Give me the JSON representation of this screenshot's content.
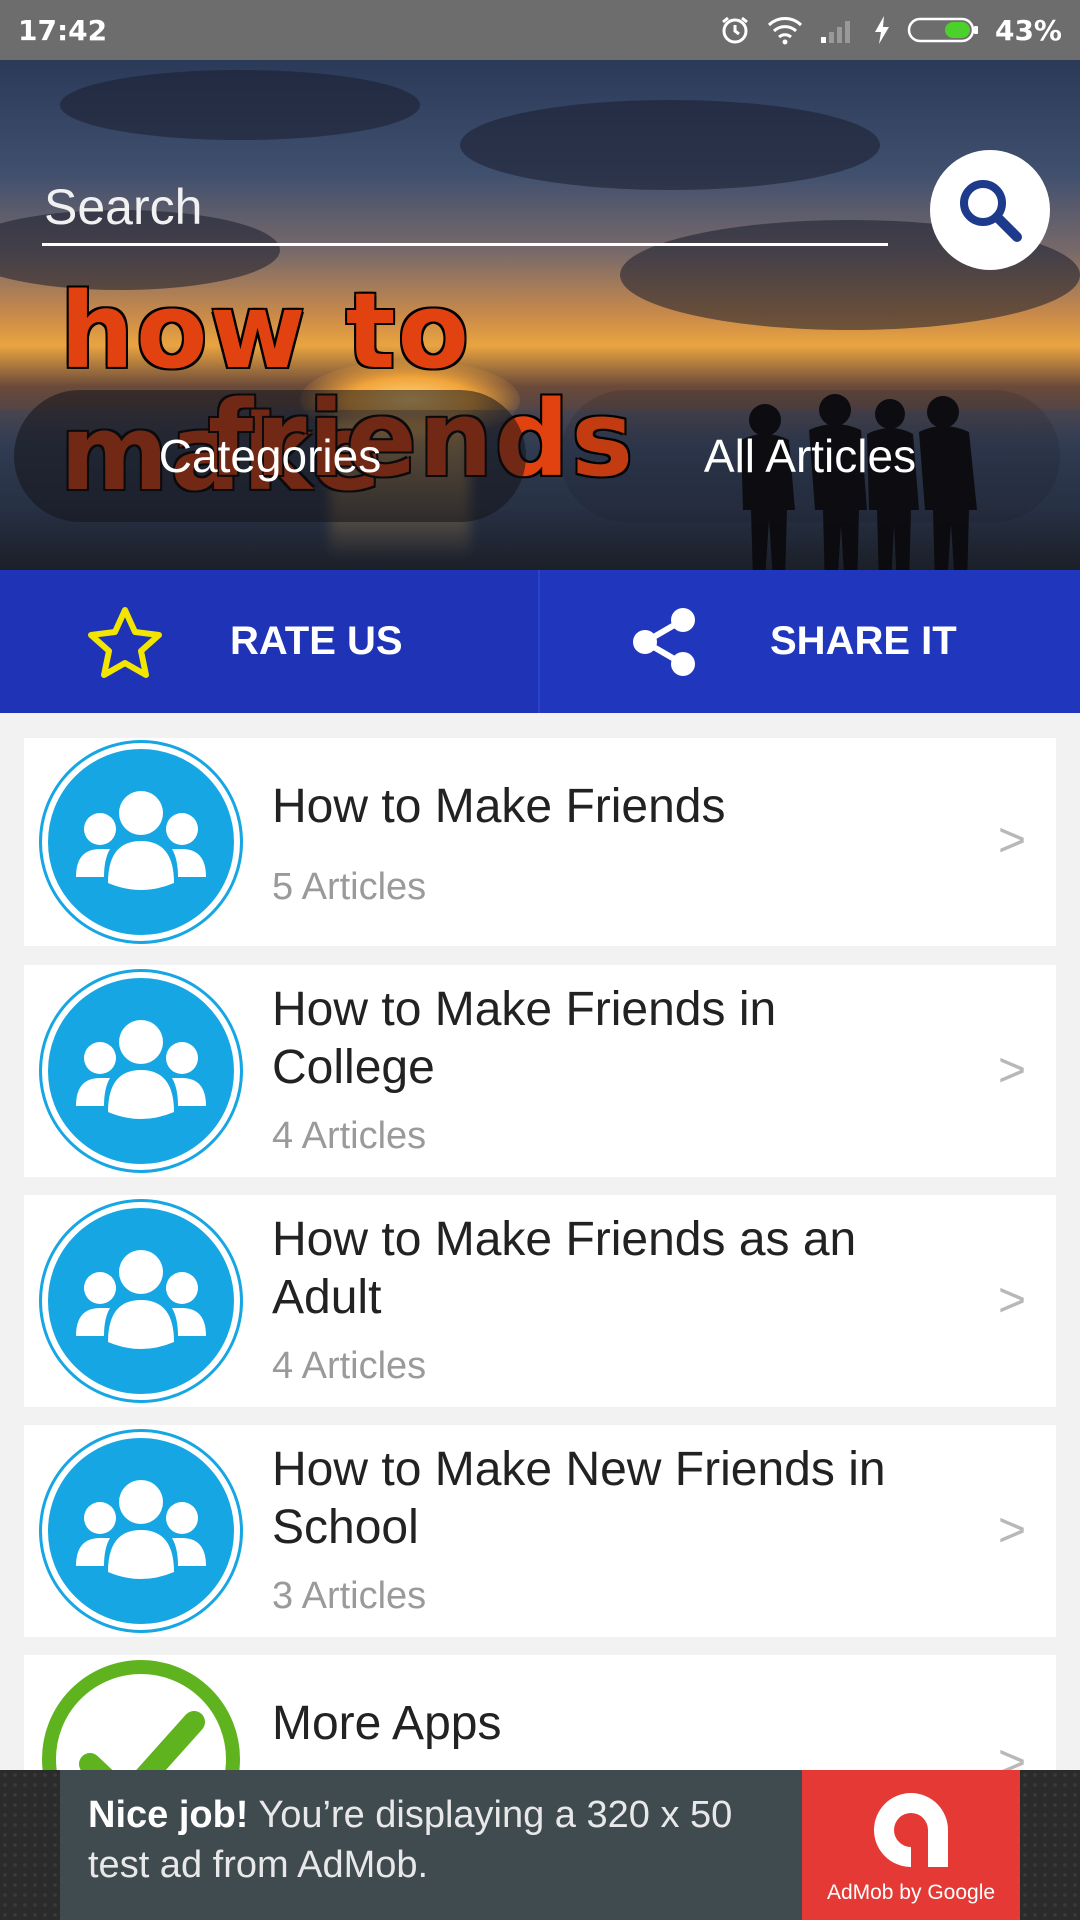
{
  "status_bar": {
    "time": "17:42",
    "battery_percent": "43%",
    "battery_level": 0.43,
    "icons": [
      "alarm-icon",
      "wifi-icon",
      "signal-icon",
      "charging-icon",
      "battery-icon"
    ]
  },
  "header": {
    "search_placeholder": "Search",
    "logo_line1": "how to make",
    "logo_line2": "friends",
    "categories_label": "Categories",
    "all_articles_label": "All Articles"
  },
  "actions": {
    "rate_label": "RATE US",
    "share_label": "SHARE IT",
    "colors": {
      "bar": "#1e33b6",
      "star": "#f2e600"
    }
  },
  "categories": [
    {
      "title": "How to Make Friends",
      "count": "5 Articles",
      "icon": "group-icon"
    },
    {
      "title": "How to Make Friends in College",
      "count": "4 Articles",
      "icon": "group-icon"
    },
    {
      "title": "How to Make Friends as an Adult",
      "count": "4 Articles",
      "icon": "group-icon"
    },
    {
      "title": "How to Make New Friends in School",
      "count": "3 Articles",
      "icon": "group-icon"
    },
    {
      "title": "More Apps",
      "icon": "checkmark-icon"
    }
  ],
  "chevron": ">",
  "ad": {
    "headline": "Nice job!",
    "body": "You’re displaying a 320 x 50 test ad from AdMob.",
    "logo_caption": "AdMob by Google"
  },
  "colors": {
    "accent_blue": "#16a6e3",
    "more_apps_green": "#5fb31e",
    "ad_red": "#e53935"
  }
}
